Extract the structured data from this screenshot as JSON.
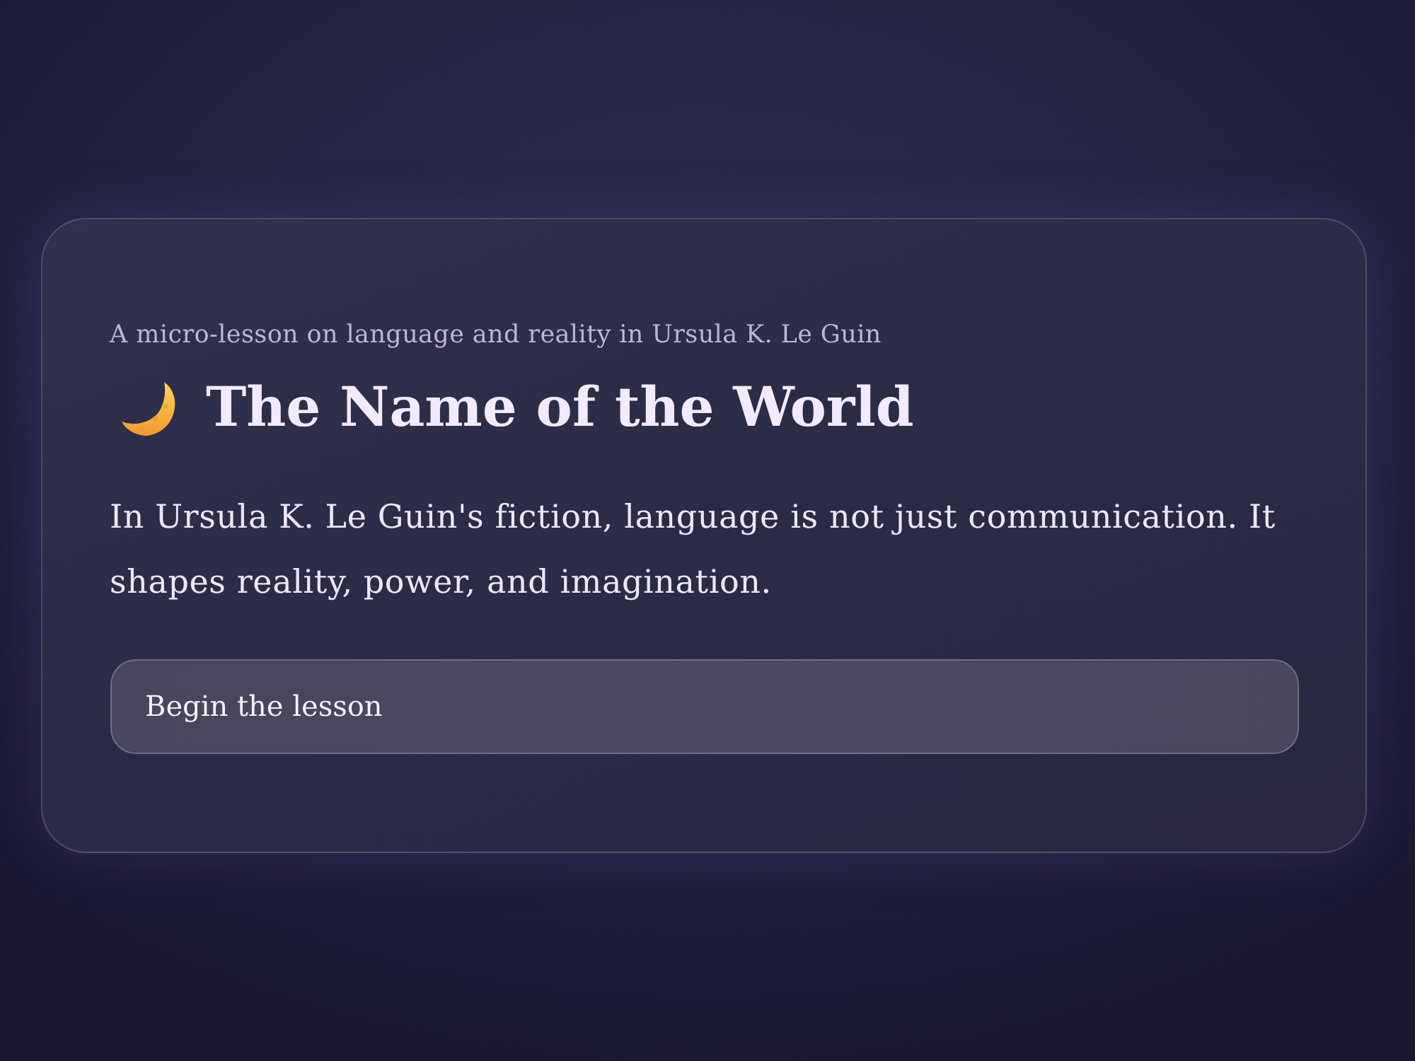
{
  "lesson": {
    "subtitle": "A micro-lesson on language and reality in Ursula K. Le Guin",
    "title": "The Name of the World",
    "intro": "In Ursula K. Le Guin's fiction, language is not just communication. It shapes reality, power, and imagination."
  },
  "start_button": {
    "label": "Begin the lesson"
  }
}
